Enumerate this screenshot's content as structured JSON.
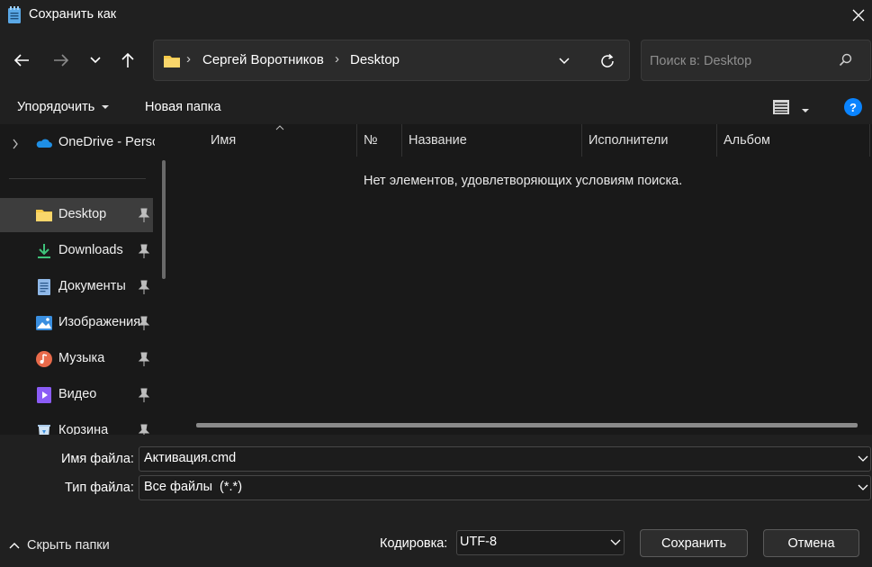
{
  "window": {
    "title": "Сохранить как",
    "close_icon": "close-icon"
  },
  "address_bar": {
    "crumbs": [
      "Сергей Воротников",
      "Desktop"
    ]
  },
  "search": {
    "placeholder": "Поиск в: Desktop"
  },
  "toolbar": {
    "organize": "Упорядочить",
    "new_folder": "Новая папка",
    "help": "?"
  },
  "sidebar": {
    "items": [
      {
        "label": "OneDrive - Personal",
        "icon": "onedrive-icon"
      },
      {
        "label": "Desktop",
        "icon": "folder-icon",
        "pinned": true,
        "selected": true
      },
      {
        "label": "Downloads",
        "icon": "download-icon",
        "pinned": true
      },
      {
        "label": "Документы",
        "icon": "document-icon",
        "pinned": true
      },
      {
        "label": "Изображения",
        "icon": "pictures-icon",
        "pinned": true
      },
      {
        "label": "Музыка",
        "icon": "music-icon",
        "pinned": true
      },
      {
        "label": "Видео",
        "icon": "video-icon",
        "pinned": true
      },
      {
        "label": "Корзина",
        "icon": "recycle-bin-icon",
        "pinned": true
      }
    ]
  },
  "file_list": {
    "columns": [
      "Имя",
      "№",
      "Название",
      "Исполнители",
      "Альбом"
    ],
    "empty_message": "Нет элементов, удовлетворяющих условиям поиска."
  },
  "footer": {
    "filename_label": "Имя файла:",
    "filename_value": "Активация.cmd",
    "filetype_label": "Тип файла:",
    "filetype_value": "Все файлы  (*.*)",
    "hide_folders": "Скрыть папки",
    "encoding_label": "Кодировка:",
    "encoding_value": "UTF-8",
    "save": "Сохранить",
    "cancel": "Отмена"
  },
  "colors": {
    "background": "#202020",
    "pane": "#191919",
    "accent_blue": "#0a84ff",
    "folder_yellow": "#f7c948"
  }
}
